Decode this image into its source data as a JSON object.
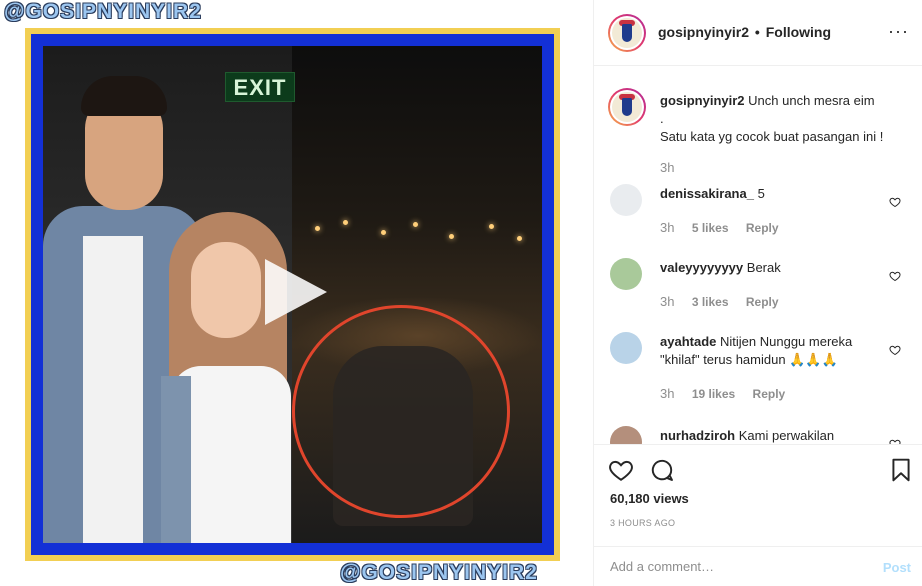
{
  "media": {
    "watermark_top": "@GOSIPNYINYIR2",
    "watermark_bottom": "@GOSIPNYINYIR2",
    "exit_sign": "EXIT",
    "frame_outer_color": "#f2cf53",
    "frame_inner_color": "#1330d6",
    "highlight_circle_color": "#e0452c"
  },
  "header": {
    "username": "gosipnyinyir2",
    "separator": "•",
    "follow_status": "Following",
    "more_icon": "ellipsis-icon"
  },
  "caption": {
    "username": "gosipnyinyir2",
    "line1": "Unch unch mesra eim",
    "line2": ".",
    "line3": "Satu kata yg cocok buat pasangan ini !",
    "time": "3h"
  },
  "comments": [
    {
      "username": "denissakirana_",
      "text": "5",
      "time": "3h",
      "likes": "5 likes",
      "reply": "Reply"
    },
    {
      "username": "valeyyyyyyyy",
      "text": "Berak",
      "time": "3h",
      "likes": "3 likes",
      "reply": "Reply"
    },
    {
      "username": "ayahtade",
      "text": "Nitijen Nunggu mereka \"khilaf\" terus hamidun 🙏🙏🙏",
      "time": "3h",
      "likes": "19 likes",
      "reply": "Reply"
    },
    {
      "username": "nurhadziroh",
      "text": "Kami perwakilan",
      "time": "",
      "likes": "",
      "reply": ""
    }
  ],
  "actions": {
    "like_icon": "heart-icon",
    "comment_icon": "comment-icon",
    "save_icon": "bookmark-icon",
    "views": "60,180 views",
    "posted_ago": "3 HOURS AGO"
  },
  "add_comment": {
    "placeholder": "Add a comment…",
    "post_label": "Post",
    "post_color": "#b2dffc"
  }
}
